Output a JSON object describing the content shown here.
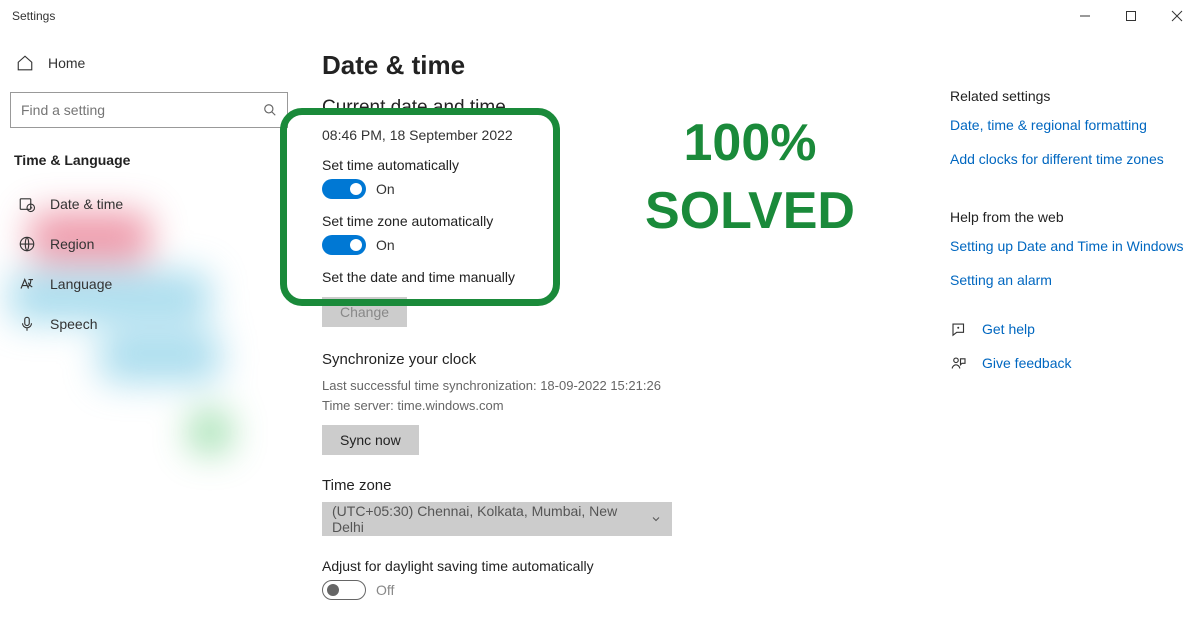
{
  "window": {
    "title": "Settings"
  },
  "sidebar": {
    "home": "Home",
    "search_placeholder": "Find a setting",
    "category": "Time & Language",
    "items": [
      {
        "label": "Date & time"
      },
      {
        "label": "Region"
      },
      {
        "label": "Language"
      },
      {
        "label": "Speech"
      }
    ]
  },
  "main": {
    "title": "Date & time",
    "current_head": "Current date and time",
    "current_value": "08:46 PM, 18 September 2022",
    "auto_time_label": "Set time automatically",
    "auto_time_state": "On",
    "auto_tz_label": "Set time zone automatically",
    "auto_tz_state": "On",
    "manual_label": "Set the date and time manually",
    "change_btn": "Change",
    "sync_head": "Synchronize your clock",
    "sync_last": "Last successful time synchronization: 18-09-2022 15:21:26",
    "sync_server": "Time server: time.windows.com",
    "sync_btn": "Sync now",
    "tz_head": "Time zone",
    "tz_value": "(UTC+05:30) Chennai, Kolkata, Mumbai, New Delhi",
    "dst_label": "Adjust for daylight saving time automatically",
    "dst_state": "Off"
  },
  "right": {
    "related_head": "Related settings",
    "related_links": [
      "Date, time & regional formatting",
      "Add clocks for different time zones"
    ],
    "web_head": "Help from the web",
    "web_links": [
      "Setting up Date and Time in Windows",
      "Setting an alarm"
    ],
    "get_help": "Get help",
    "feedback": "Give feedback"
  },
  "overlay": {
    "line1": "100%",
    "line2": "SOLVED"
  }
}
